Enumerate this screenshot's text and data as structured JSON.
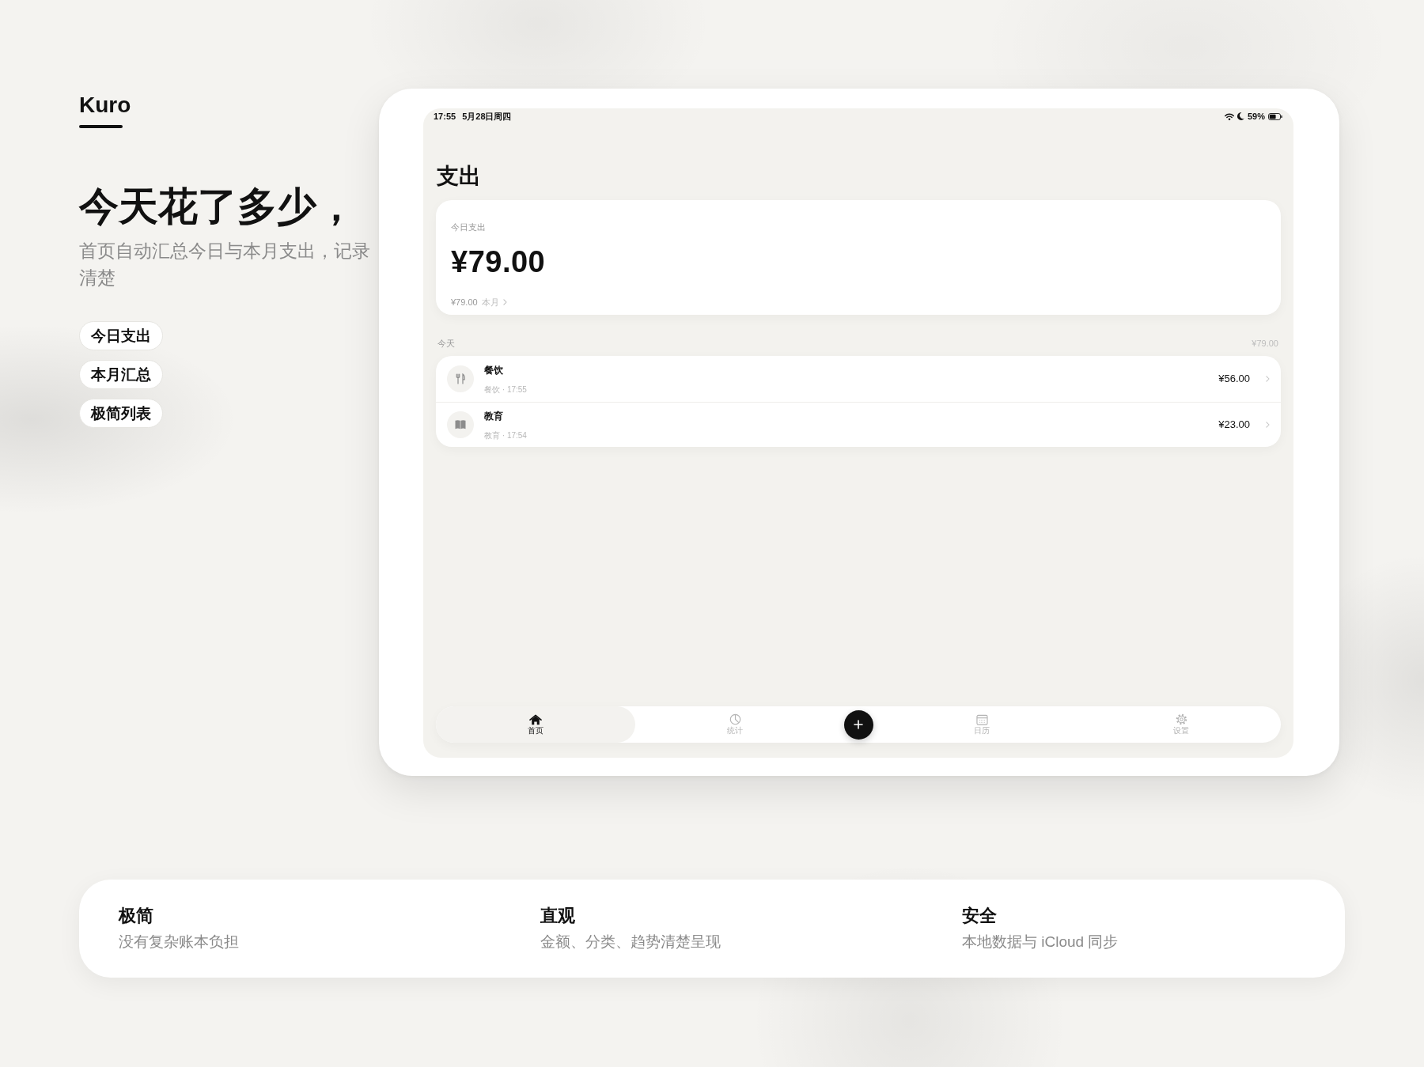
{
  "brand": {
    "name": "Kuro"
  },
  "hero": {
    "headline": "今天花了多少，",
    "subtitle_lines": [
      "首页自动汇总今日与本月支出，记录",
      "清楚"
    ],
    "tags": [
      "今日支出",
      "本月汇总",
      "极简列表"
    ]
  },
  "device": {
    "status_bar": {
      "time": "17:55",
      "date": "5月28日周四",
      "battery": "59%"
    },
    "title": "支出",
    "summary": {
      "label": "今日支出",
      "amount": "¥79.00",
      "month_amount": "¥79.00",
      "month_label": "本月"
    },
    "section": {
      "title": "今天",
      "total": "¥79.00"
    },
    "transactions": [
      {
        "kind": "dining",
        "title": "餐饮",
        "meta": "餐饮 · 17:55",
        "amount": "¥56.00"
      },
      {
        "kind": "education",
        "title": "教育",
        "meta": "教育 · 17:54",
        "amount": "¥23.00"
      }
    ],
    "tab_bar": {
      "tabs": [
        {
          "kind": "home",
          "label": "首页",
          "selected": true
        },
        {
          "kind": "stats",
          "label": "统计",
          "selected": false
        },
        {
          "kind": "calendar",
          "label": "日历",
          "selected": false
        },
        {
          "kind": "settings",
          "label": "设置",
          "selected": false
        }
      ]
    }
  },
  "features": [
    {
      "title": "极简",
      "description": "没有复杂账本负担"
    },
    {
      "title": "直观",
      "description": "金额、分类、趋势清楚呈现"
    },
    {
      "title": "安全",
      "description": "本地数据与 iCloud 同步"
    }
  ]
}
